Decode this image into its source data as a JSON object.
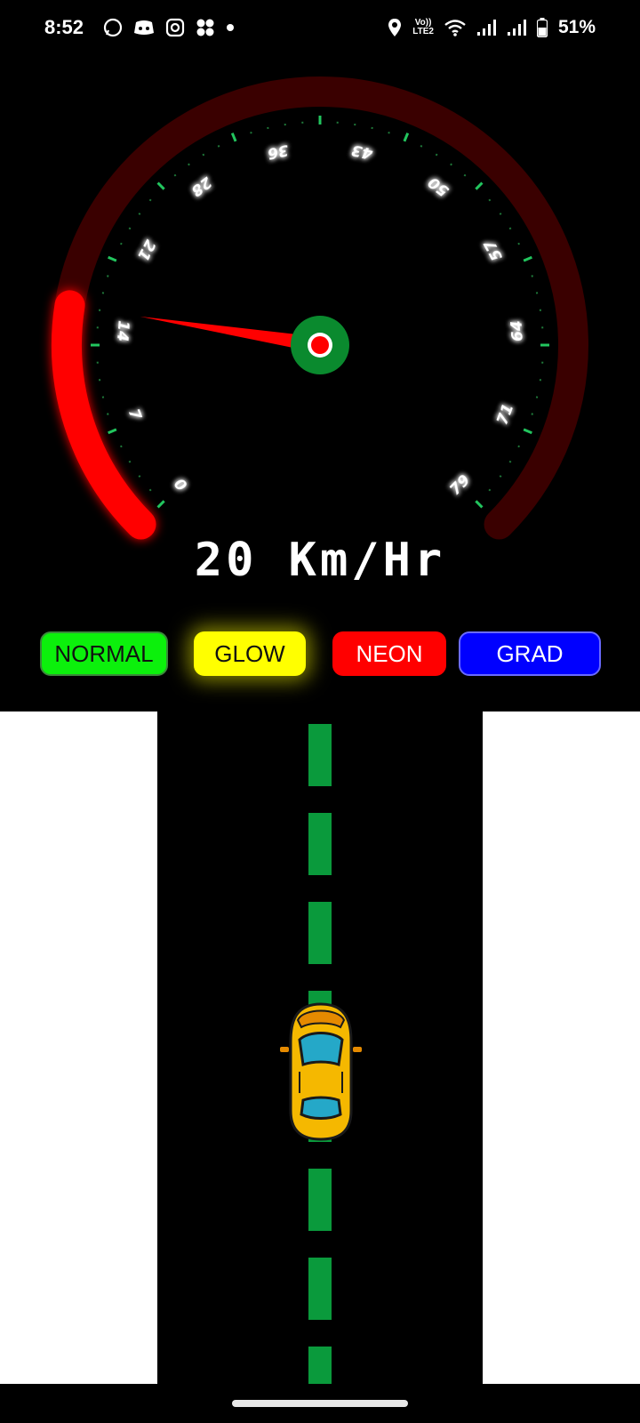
{
  "status_bar": {
    "time": "8:52",
    "notification_icons": [
      "whatsapp-icon",
      "discord-icon",
      "instagram-icon",
      "pinwheel-icon",
      "dot-icon"
    ],
    "lte_label": "LTE2",
    "battery": "51%"
  },
  "gauge": {
    "unit_readout": "20 Km/Hr",
    "speed_value": 20,
    "scale_min": 0,
    "scale_max": 100,
    "tick_labels": [
      "0",
      "7",
      "14",
      "21",
      "28",
      "36",
      "43",
      "50",
      "57",
      "64",
      "71",
      "79"
    ],
    "colors": {
      "active_arc": "#ff0000",
      "inactive_arc": "#3a0000",
      "needle": "#ff0000",
      "hub": "#0a8a2e",
      "ticks": "#22c55e"
    }
  },
  "modes": {
    "normal": "NORMAL",
    "glow": "GLOW",
    "neon": "NEON",
    "grad": "GRAD"
  },
  "road": {
    "lane_color": "#0a9a3c",
    "car_color": "#f5b800"
  }
}
